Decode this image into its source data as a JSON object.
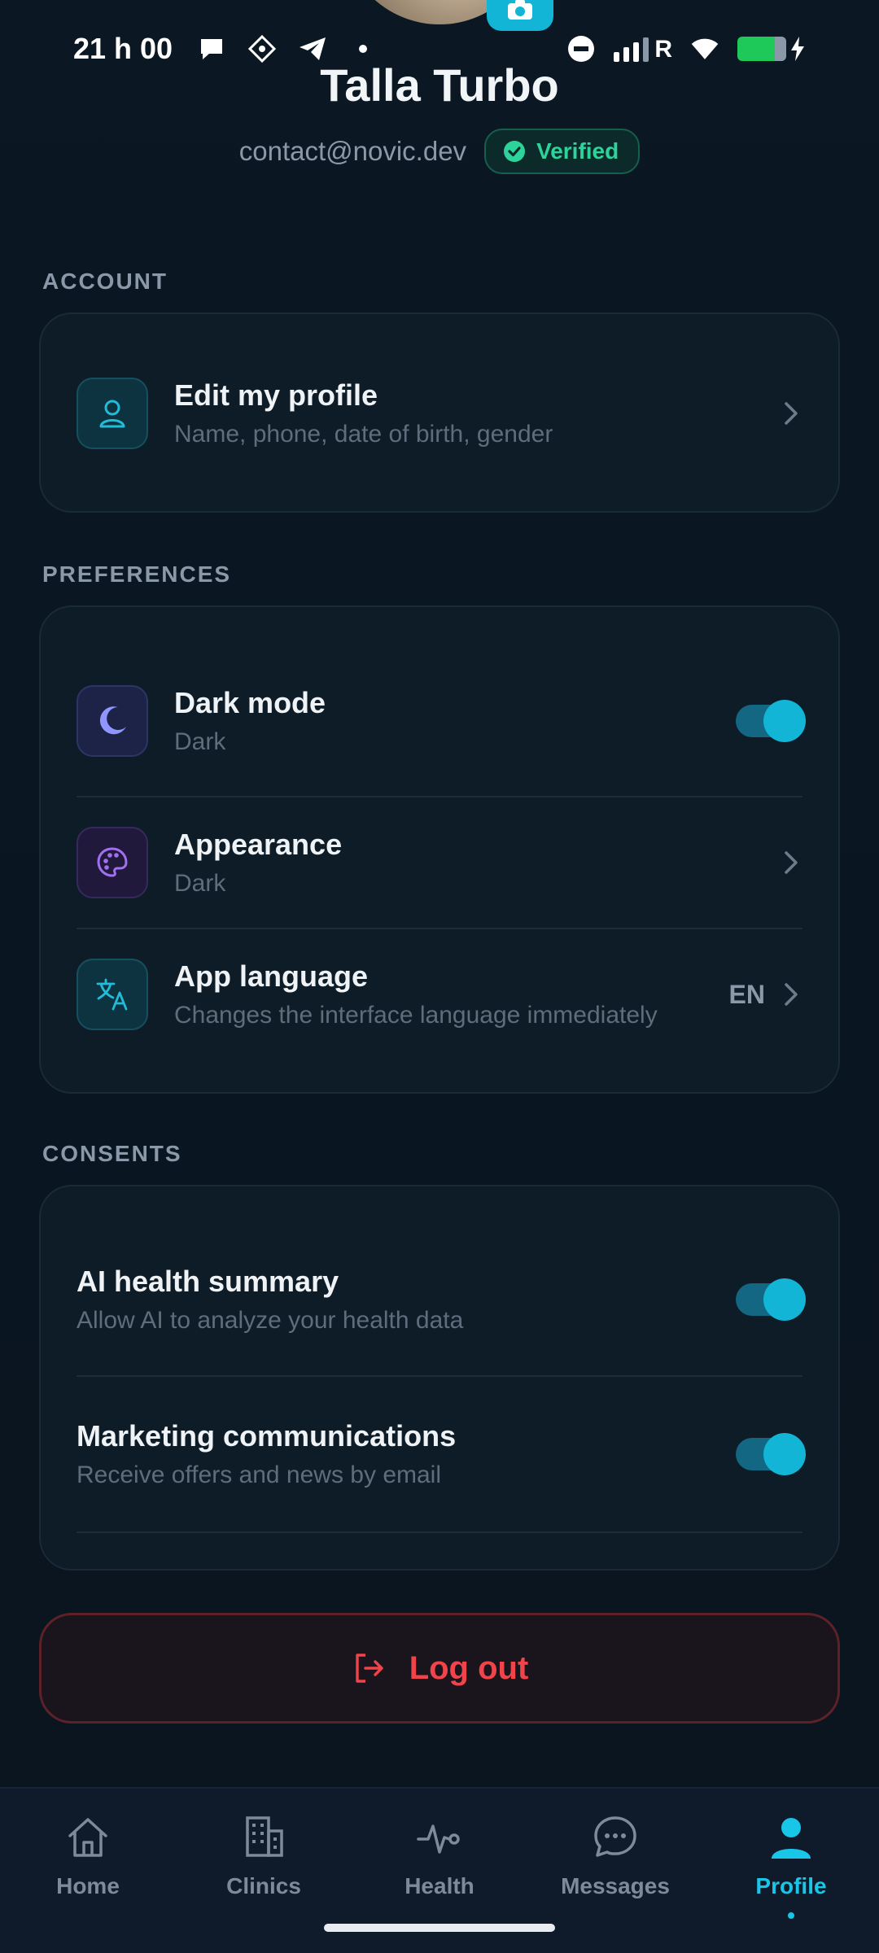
{
  "status_bar": {
    "time": "21 h 00",
    "network_label": "R"
  },
  "profile": {
    "name": "Talla Turbo",
    "email": "contact@novic.dev",
    "verified_label": "Verified"
  },
  "sections": {
    "account": {
      "title": "ACCOUNT",
      "items": [
        {
          "title": "Edit my profile",
          "subtitle": "Name, phone, date of birth, gender",
          "icon": "user-icon"
        }
      ]
    },
    "preferences": {
      "title": "PREFERENCES",
      "items": [
        {
          "title": "Dark mode",
          "subtitle": "Dark",
          "icon": "moon-icon",
          "toggle_on": true
        },
        {
          "title": "Appearance",
          "subtitle": "Dark",
          "icon": "palette-icon"
        },
        {
          "title": "App language",
          "subtitle": "Changes the interface language immediately",
          "icon": "translate-icon",
          "value": "EN"
        }
      ]
    },
    "consents": {
      "title": "CONSENTS",
      "items": [
        {
          "title": "AI health summary",
          "subtitle": "Allow AI to analyze your health data",
          "toggle_on": true
        },
        {
          "title": "Marketing communications",
          "subtitle": "Receive offers and news by email",
          "toggle_on": true
        }
      ]
    }
  },
  "logout_label": "Log out",
  "bottom_nav": [
    {
      "label": "Home",
      "icon": "home-icon",
      "active": false
    },
    {
      "label": "Clinics",
      "icon": "building-icon",
      "active": false
    },
    {
      "label": "Health",
      "icon": "pulse-icon",
      "active": false
    },
    {
      "label": "Messages",
      "icon": "chat-bubble-icon",
      "active": false
    },
    {
      "label": "Profile",
      "icon": "person-icon",
      "active": true
    }
  ],
  "colors": {
    "accent": "#12b5d6",
    "danger": "#f0444b",
    "success": "#2dd39b",
    "background": "#0a1520",
    "card": "#0e1c28"
  }
}
